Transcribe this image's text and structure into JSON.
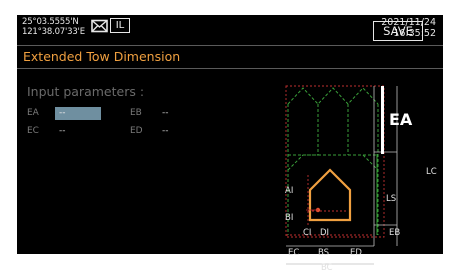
{
  "header": {
    "lat": "25°03.5555'N",
    "lon": "121°38.07'33'E",
    "mail_icon": "envelope-icon",
    "il_badge": "IL",
    "date": "2021/11/24",
    "time": "16:35:52"
  },
  "title": "Extended Tow Dimension",
  "save_label": "SAVE",
  "params": {
    "heading": "Input parameters :",
    "ea_label": "EA",
    "ea_value": "--",
    "eb_label": "EB",
    "eb_value": "--",
    "ec_label": "EC",
    "ec_value": "--",
    "ed_label": "ED",
    "ed_value": "--"
  },
  "diagram": {
    "ea": "EA",
    "lc": "LC",
    "ls": "LS",
    "eb": "EB",
    "ai": "AI",
    "bi": "BI",
    "ci": "CI",
    "di": "DI",
    "ec": "EC",
    "bs": "BS",
    "ed": "ED",
    "bc": "BC"
  },
  "colors": {
    "accent_orange": "#f0a040",
    "ship_green": "#3aa03a",
    "dim_red": "#c03030",
    "highlight": "#6f8fa0"
  }
}
